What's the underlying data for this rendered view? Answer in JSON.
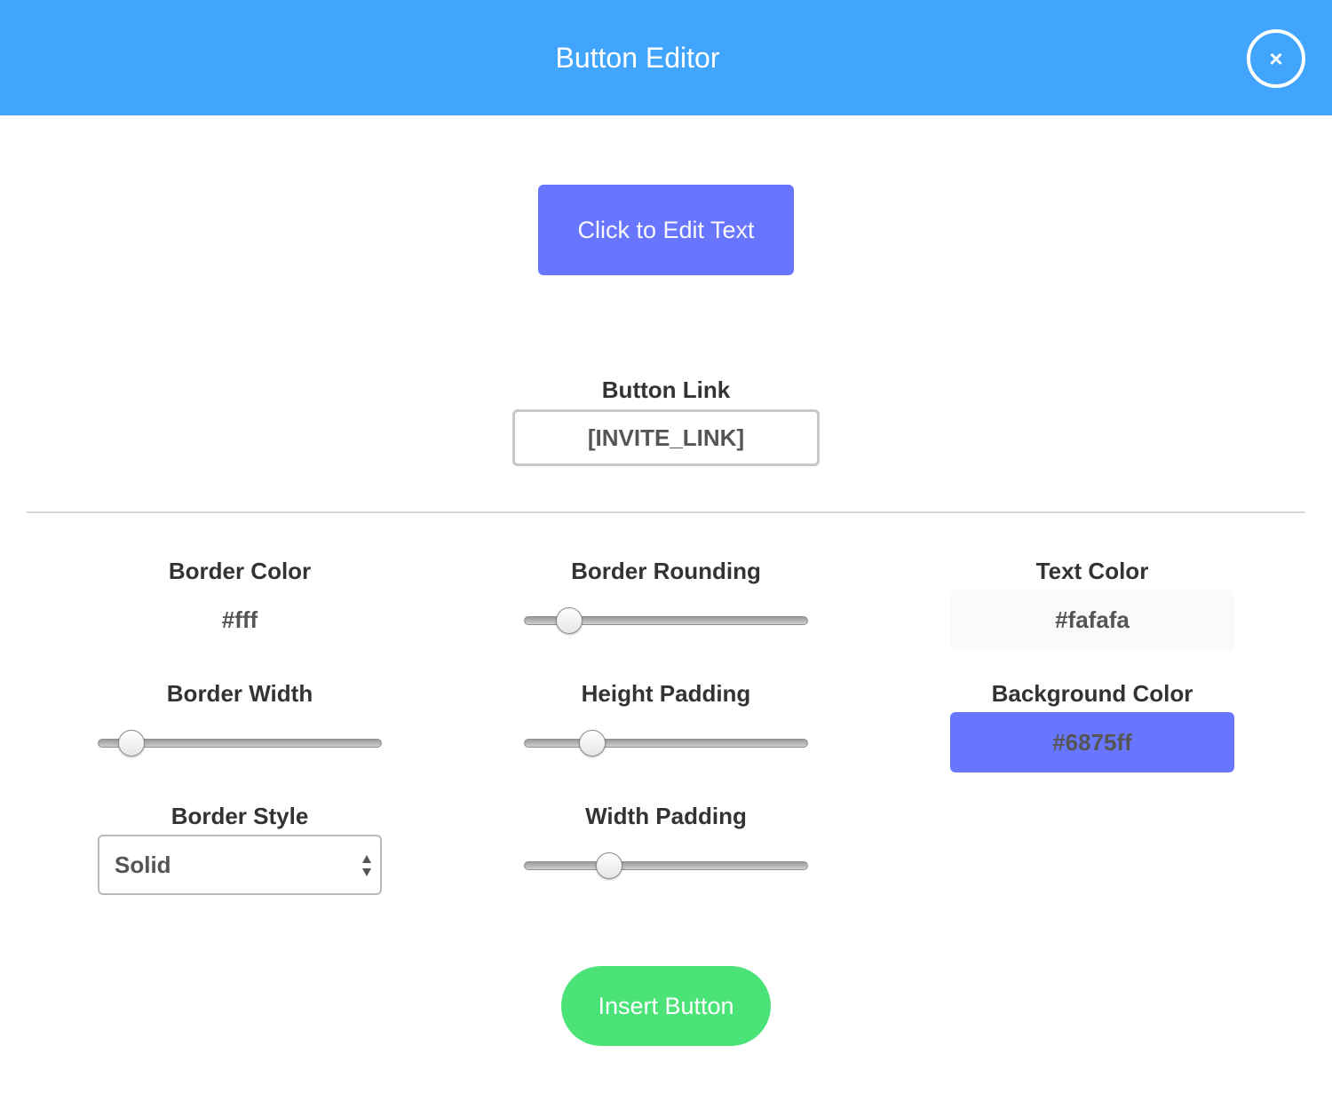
{
  "header": {
    "title": "Button Editor",
    "close_icon": "×",
    "background_color": "#42a5fd"
  },
  "preview": {
    "button_text": "Click to Edit Text",
    "background_color": "#6875ff",
    "text_color": "#fafafa"
  },
  "link": {
    "label": "Button Link",
    "value": "[INVITE_LINK]"
  },
  "settings": {
    "border_color": {
      "label": "Border Color",
      "value": "#fff"
    },
    "border_width": {
      "label": "Border Width",
      "level": 0.12
    },
    "border_style": {
      "label": "Border Style",
      "selected": "Solid"
    },
    "border_rounding": {
      "label": "Border Rounding",
      "level": 0.16
    },
    "height_padding": {
      "label": "Height Padding",
      "level": 0.24
    },
    "width_padding": {
      "label": "Width Padding",
      "level": 0.3
    },
    "text_color": {
      "label": "Text Color",
      "value": "#fafafa"
    },
    "background_color": {
      "label": "Background Color",
      "value": "#6875ff"
    }
  },
  "footer": {
    "insert_label": "Insert Button",
    "insert_color": "#4be278"
  }
}
